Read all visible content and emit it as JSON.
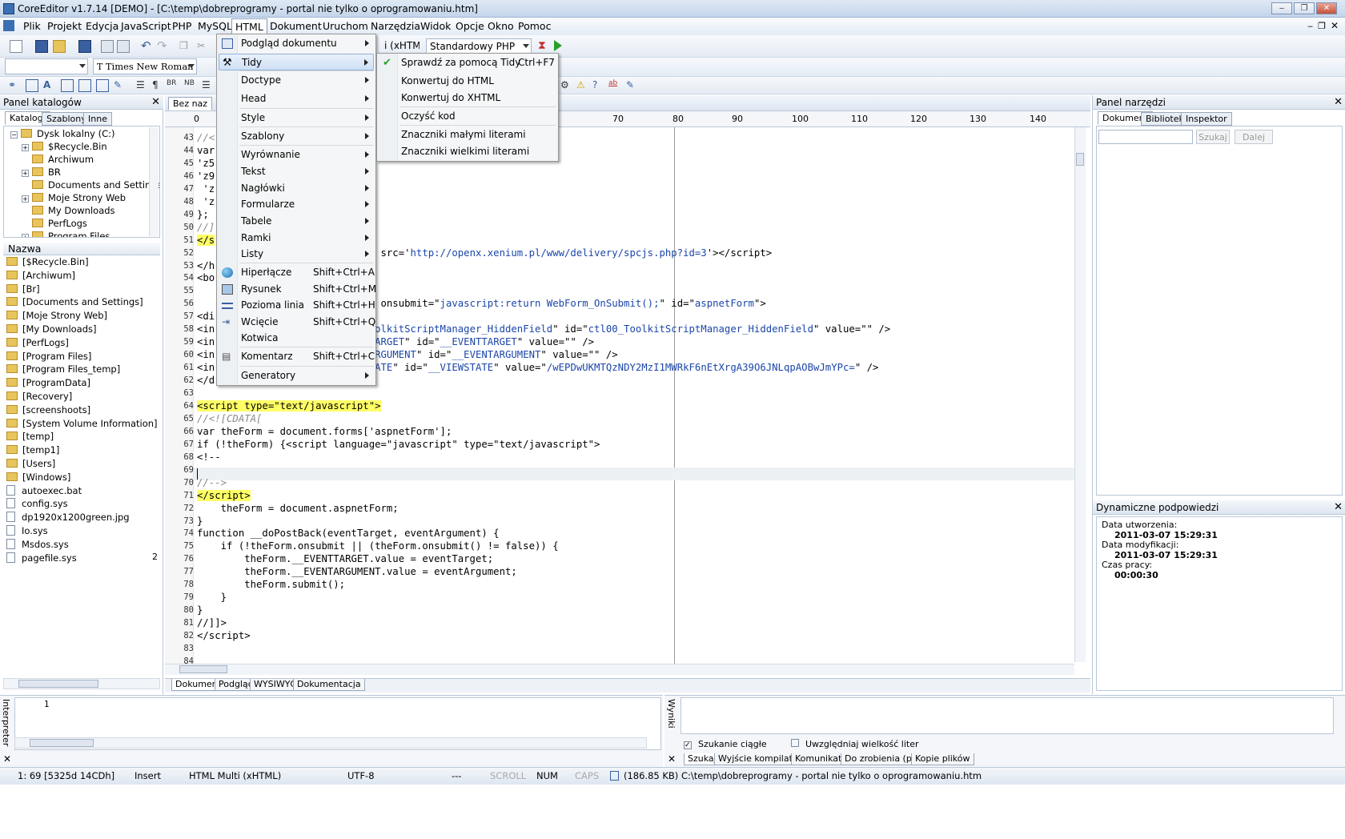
{
  "window": {
    "title": "CoreEditor v1.7.14 [DEMO] - [C:\\temp\\dobreprogramy - portal nie tylko o oprogramowaniu.htm]",
    "min": "‒",
    "max": "❐",
    "close": "✕"
  },
  "menubar": [
    "Plik",
    "Projekt",
    "Edycja",
    "JavaScript",
    "PHP",
    "MySQL",
    "HTML",
    "Dokument",
    "Uruchom",
    "Narzędzia",
    "Widok",
    "Opcje",
    "Okno",
    "Pomoc"
  ],
  "toolbar": {
    "lang_combo": "i (xHTML)",
    "php_combo": "Standardowy PHP",
    "font_combo": "Times New Roman",
    "size_combo": ""
  },
  "left_panel": {
    "title": "Panel katalogów",
    "close": "✕",
    "tabs": [
      "Katalogi",
      "Szablony",
      "Inne"
    ],
    "tree": [
      {
        "label": "Dysk lokalny (C:)",
        "pm": "−"
      },
      {
        "label": "$Recycle.Bin",
        "pm": "+"
      },
      {
        "label": "Archiwum",
        "pm": ""
      },
      {
        "label": "BR",
        "pm": "+"
      },
      {
        "label": "Documents and Settings",
        "pm": ""
      },
      {
        "label": "Moje Strony Web",
        "pm": "+"
      },
      {
        "label": "My Downloads",
        "pm": ""
      },
      {
        "label": "PerfLogs",
        "pm": ""
      },
      {
        "label": "Program Files",
        "pm": "+"
      }
    ],
    "list_header": "Nazwa",
    "files": [
      {
        "name": "[$Recycle.Bin]",
        "type": "folder"
      },
      {
        "name": "[Archiwum]",
        "type": "folder"
      },
      {
        "name": "[Br]",
        "type": "folder"
      },
      {
        "name": "[Documents and Settings]",
        "type": "folder"
      },
      {
        "name": "[Moje Strony Web]",
        "type": "folder"
      },
      {
        "name": "[My Downloads]",
        "type": "folder"
      },
      {
        "name": "[PerfLogs]",
        "type": "folder"
      },
      {
        "name": "[Program Files]",
        "type": "folder"
      },
      {
        "name": "[Program Files_temp]",
        "type": "folder"
      },
      {
        "name": "[ProgramData]",
        "type": "folder"
      },
      {
        "name": "[Recovery]",
        "type": "folder"
      },
      {
        "name": "[screenshoots]",
        "type": "folder"
      },
      {
        "name": "[System Volume Information]",
        "type": "folder"
      },
      {
        "name": "[temp]",
        "type": "folder"
      },
      {
        "name": "[temp1]",
        "type": "folder"
      },
      {
        "name": "[Users]",
        "type": "folder"
      },
      {
        "name": "[Windows]",
        "type": "folder"
      },
      {
        "name": "autoexec.bat",
        "type": "file"
      },
      {
        "name": "config.sys",
        "type": "file"
      },
      {
        "name": "dp1920x1200green.jpg",
        "type": "file"
      },
      {
        "name": "Io.sys",
        "type": "file"
      },
      {
        "name": "Msdos.sys",
        "type": "file"
      },
      {
        "name": "pagefile.sys",
        "type": "file"
      }
    ],
    "pagefile_size": "2"
  },
  "editor": {
    "tab_label": "Bez naz",
    "ruler": [
      "0",
      "70",
      "80",
      "90",
      "100",
      "110",
      "120",
      "130",
      "140"
    ],
    "lines": [
      {
        "n": "43",
        "html": "<span class=\"cm\">//&lt;</span>"
      },
      {
        "n": "44",
        "html": "var"
      },
      {
        "n": "45",
        "html": "'z5"
      },
      {
        "n": "46",
        "html": "'z9"
      },
      {
        "n": "47",
        "html": " 'z"
      },
      {
        "n": "48",
        "html": " 'z"
      },
      {
        "n": "49",
        "html": "};"
      },
      {
        "n": "50",
        "html": "<span class=\"cm\">//]</span>"
      },
      {
        "n": "51",
        "html": "<span class=\"hl\">&lt;/s</span>"
      },
      {
        "n": "52",
        "html": "                          ipt' src='<span class=\"str\">http://openx.xenium.pl/www/delivery/spcjs.php?id=3</span>'&gt;&lt;/script&gt;"
      },
      {
        "n": "53",
        "html": "&lt;/h"
      },
      {
        "n": "54",
        "html": "&lt;bo"
      },
      {
        "n": "55",
        "html": ""
      },
      {
        "n": "56",
        "html": "                          =\"/\" onsubmit=\"<span class=\"str\">javascript:return WebForm_OnSubmit();</span>\" id=\"<span class=\"str\">aspnetForm</span>\"&gt;"
      },
      {
        "n": "57",
        "html": "&lt;di"
      },
      {
        "n": "58",
        "html": "&lt;in                      <span class=\"str\">00_ToolkitScriptManager_HiddenField</span>\" id=\"<span class=\"str\">ctl00_ToolkitScriptManager_HiddenField</span>\" value=\"\" /&gt;"
      },
      {
        "n": "59",
        "html": "&lt;in                      <span class=\"str\">VENTTARGET</span>\" id=\"<span class=\"str\">__EVENTTARGET</span>\" value=\"\" /&gt;"
      },
      {
        "n": "60",
        "html": "&lt;in                      <span class=\"str\">VENTARGUMENT</span>\" id=\"<span class=\"str\">__EVENTARGUMENT</span>\" value=\"\" /&gt;"
      },
      {
        "n": "61",
        "html": "&lt;in                      <span class=\"str\">IEWSTATE</span>\" id=\"<span class=\"str\">__VIEWSTATE</span>\" value=\"<span class=\"str\">/wEPDwUKMTQzNDY2MzI1MWRkF6nEtXrgA39O6JNLqpAOBwJmYPc=</span>\" /&gt;"
      },
      {
        "n": "62",
        "html": "&lt;/d"
      },
      {
        "n": "63",
        "html": ""
      },
      {
        "n": "64",
        "html": "<span class=\"hl\">&lt;script type=\"text/javascript\"&gt;</span>"
      },
      {
        "n": "65",
        "html": "<span class=\"cm\">//&lt;![CDATA[</span>"
      },
      {
        "n": "66",
        "html": "var theForm = document.forms['aspnetForm'];"
      },
      {
        "n": "67",
        "html": "if (!theForm) {&lt;script language=\"javascript\" type=\"text/javascript\"&gt;"
      },
      {
        "n": "68",
        "html": "&lt;!--"
      },
      {
        "n": "69",
        "html": ""
      },
      {
        "n": "70",
        "html": "<span class=\"cm\">//--&gt;</span>"
      },
      {
        "n": "71",
        "html": "<span class=\"hl\">&lt;/script&gt;</span>"
      },
      {
        "n": "72",
        "html": "    theForm = document.aspnetForm;"
      },
      {
        "n": "73",
        "html": "}"
      },
      {
        "n": "74",
        "html": "function __doPostBack(eventTarget, eventArgument) {"
      },
      {
        "n": "75",
        "html": "    if (!theForm.onsubmit || (theForm.onsubmit() != false)) {"
      },
      {
        "n": "76",
        "html": "        theForm.__EVENTTARGET.value = eventTarget;"
      },
      {
        "n": "77",
        "html": "        theForm.__EVENTARGUMENT.value = eventArgument;"
      },
      {
        "n": "78",
        "html": "        theForm.submit();"
      },
      {
        "n": "79",
        "html": "    }"
      },
      {
        "n": "80",
        "html": "}"
      },
      {
        "n": "81",
        "html": "//]]&gt;"
      },
      {
        "n": "82",
        "html": "&lt;/script&gt;"
      },
      {
        "n": "83",
        "html": ""
      },
      {
        "n": "84",
        "html": ""
      }
    ],
    "bottom_tabs": [
      "Dokument",
      "Podgląd",
      "WYSIWYG",
      "Dokumentacja"
    ]
  },
  "html_menu": {
    "items": [
      {
        "label": "Podgląd dokumentu",
        "shortcut": "",
        "sub": true
      },
      {
        "label": "Tidy",
        "shortcut": "",
        "sub": true,
        "hover": true
      },
      {
        "label": "Doctype",
        "shortcut": "",
        "sub": true
      },
      {
        "label": "Head",
        "shortcut": "",
        "sub": true
      },
      {
        "label": "Style",
        "shortcut": "",
        "sub": true
      },
      {
        "label": "Szablony",
        "shortcut": "",
        "sub": true
      },
      {
        "label": "Wyrównanie",
        "shortcut": "",
        "sub": true
      },
      {
        "label": "Tekst",
        "shortcut": "",
        "sub": true
      },
      {
        "label": "Nagłówki",
        "shortcut": "",
        "sub": true
      },
      {
        "label": "Formularze",
        "shortcut": "",
        "sub": true
      },
      {
        "label": "Tabele",
        "shortcut": "",
        "sub": true
      },
      {
        "label": "Ramki",
        "shortcut": "",
        "sub": true
      },
      {
        "label": "Listy",
        "shortcut": "",
        "sub": true
      },
      {
        "label": "Hiperłącze",
        "shortcut": "Shift+Ctrl+A",
        "sub": false
      },
      {
        "label": "Rysunek",
        "shortcut": "Shift+Ctrl+M",
        "sub": false
      },
      {
        "label": "Pozioma linia",
        "shortcut": "Shift+Ctrl+H",
        "sub": false
      },
      {
        "label": "Wcięcie",
        "shortcut": "Shift+Ctrl+Q",
        "sub": false
      },
      {
        "label": "Kotwica",
        "shortcut": "",
        "sub": false
      },
      {
        "label": "Komentarz",
        "shortcut": "Shift+Ctrl+C",
        "sub": false
      },
      {
        "label": "Generatory",
        "shortcut": "",
        "sub": true
      }
    ]
  },
  "tidy_menu": {
    "items": [
      {
        "label": "Sprawdź za pomocą Tidy",
        "shortcut": "Ctrl+F7"
      },
      {
        "label": "Konwertuj do HTML",
        "shortcut": ""
      },
      {
        "label": "Konwertuj do XHTML",
        "shortcut": ""
      },
      {
        "label": "Oczyść kod",
        "shortcut": ""
      },
      {
        "label": "Znaczniki małymi literami",
        "shortcut": ""
      },
      {
        "label": "Znaczniki wielkimi literami",
        "shortcut": ""
      }
    ]
  },
  "right_panel": {
    "title": "Panel narzędzi",
    "close": "✕",
    "tabs": [
      "Dokument",
      "Biblioteki",
      "Inspektor"
    ],
    "search_btn": "Szukaj",
    "next_btn": "Dalej",
    "hints_title": "Dynamiczne podpowiedzi",
    "created_label": "Data utworzenia:",
    "created": "2011-03-07 15:29:31",
    "modified_label": "Data modyfikacji:",
    "modified": "2011-03-07 15:29:31",
    "worktime_label": "Czas pracy:",
    "worktime": "00:00:30"
  },
  "interpreter": {
    "label": "Interpreter",
    "line": "1"
  },
  "results": {
    "label": "Wyniki",
    "continuous": "Szukanie ciągłe",
    "case": "Uwzględniaj wielkość liter",
    "tabs": [
      "Szukaj",
      "Wyjście kompilatora",
      "Komunikaty",
      "Do zrobienia (plik)",
      "Kopie plików"
    ]
  },
  "status": {
    "pos": "1: 69 [5325d 14CDh]",
    "mode": "Insert",
    "type": "HTML Multi (xHTML)",
    "enc": "UTF-8",
    "dash": "---",
    "scroll": "SCROLL",
    "num": "NUM",
    "caps": "CAPS",
    "file": "(186.85 KB) C:\\temp\\dobreprogramy - portal nie tylko o oprogramowaniu.htm"
  }
}
